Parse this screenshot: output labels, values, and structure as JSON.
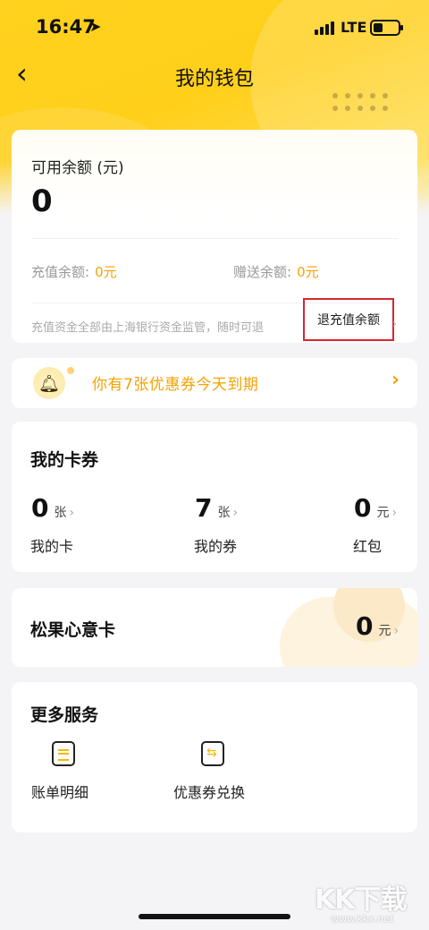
{
  "status_bar": {
    "time": "16:47",
    "network": "LTE"
  },
  "nav": {
    "title": "我的钱包"
  },
  "balance": {
    "label": "可用余额 (元)",
    "amount": "0",
    "recharge_label": "充值余额:",
    "recharge_value": "0元",
    "gift_label": "赠送余额:",
    "gift_value": "0元",
    "note": "充值资金全部由上海银行资金监管，随时可退",
    "refund_button": "退充值余额"
  },
  "notice": {
    "text": "你有7张优惠券今天到期"
  },
  "coupons": {
    "title": "我的卡券",
    "items": [
      {
        "count": "0",
        "unit": "张",
        "label": "我的卡"
      },
      {
        "count": "7",
        "unit": "张",
        "label": "我的券"
      },
      {
        "count": "0",
        "unit": "元",
        "label": "红包"
      }
    ]
  },
  "gift_card": {
    "title": "松果心意卡",
    "count": "0",
    "unit": "元"
  },
  "more": {
    "title": "更多服务",
    "items": [
      {
        "label": "账单明细",
        "icon": "bill-icon"
      },
      {
        "label": "优惠券兑换",
        "icon": "coupon-exchange-icon"
      }
    ]
  },
  "watermark": {
    "brand": "KK下载",
    "url": "www.kkx.net"
  },
  "colors": {
    "brand_yellow": "#ffd21f",
    "accent_orange": "#f5a300",
    "highlight_red": "#d8262f"
  }
}
